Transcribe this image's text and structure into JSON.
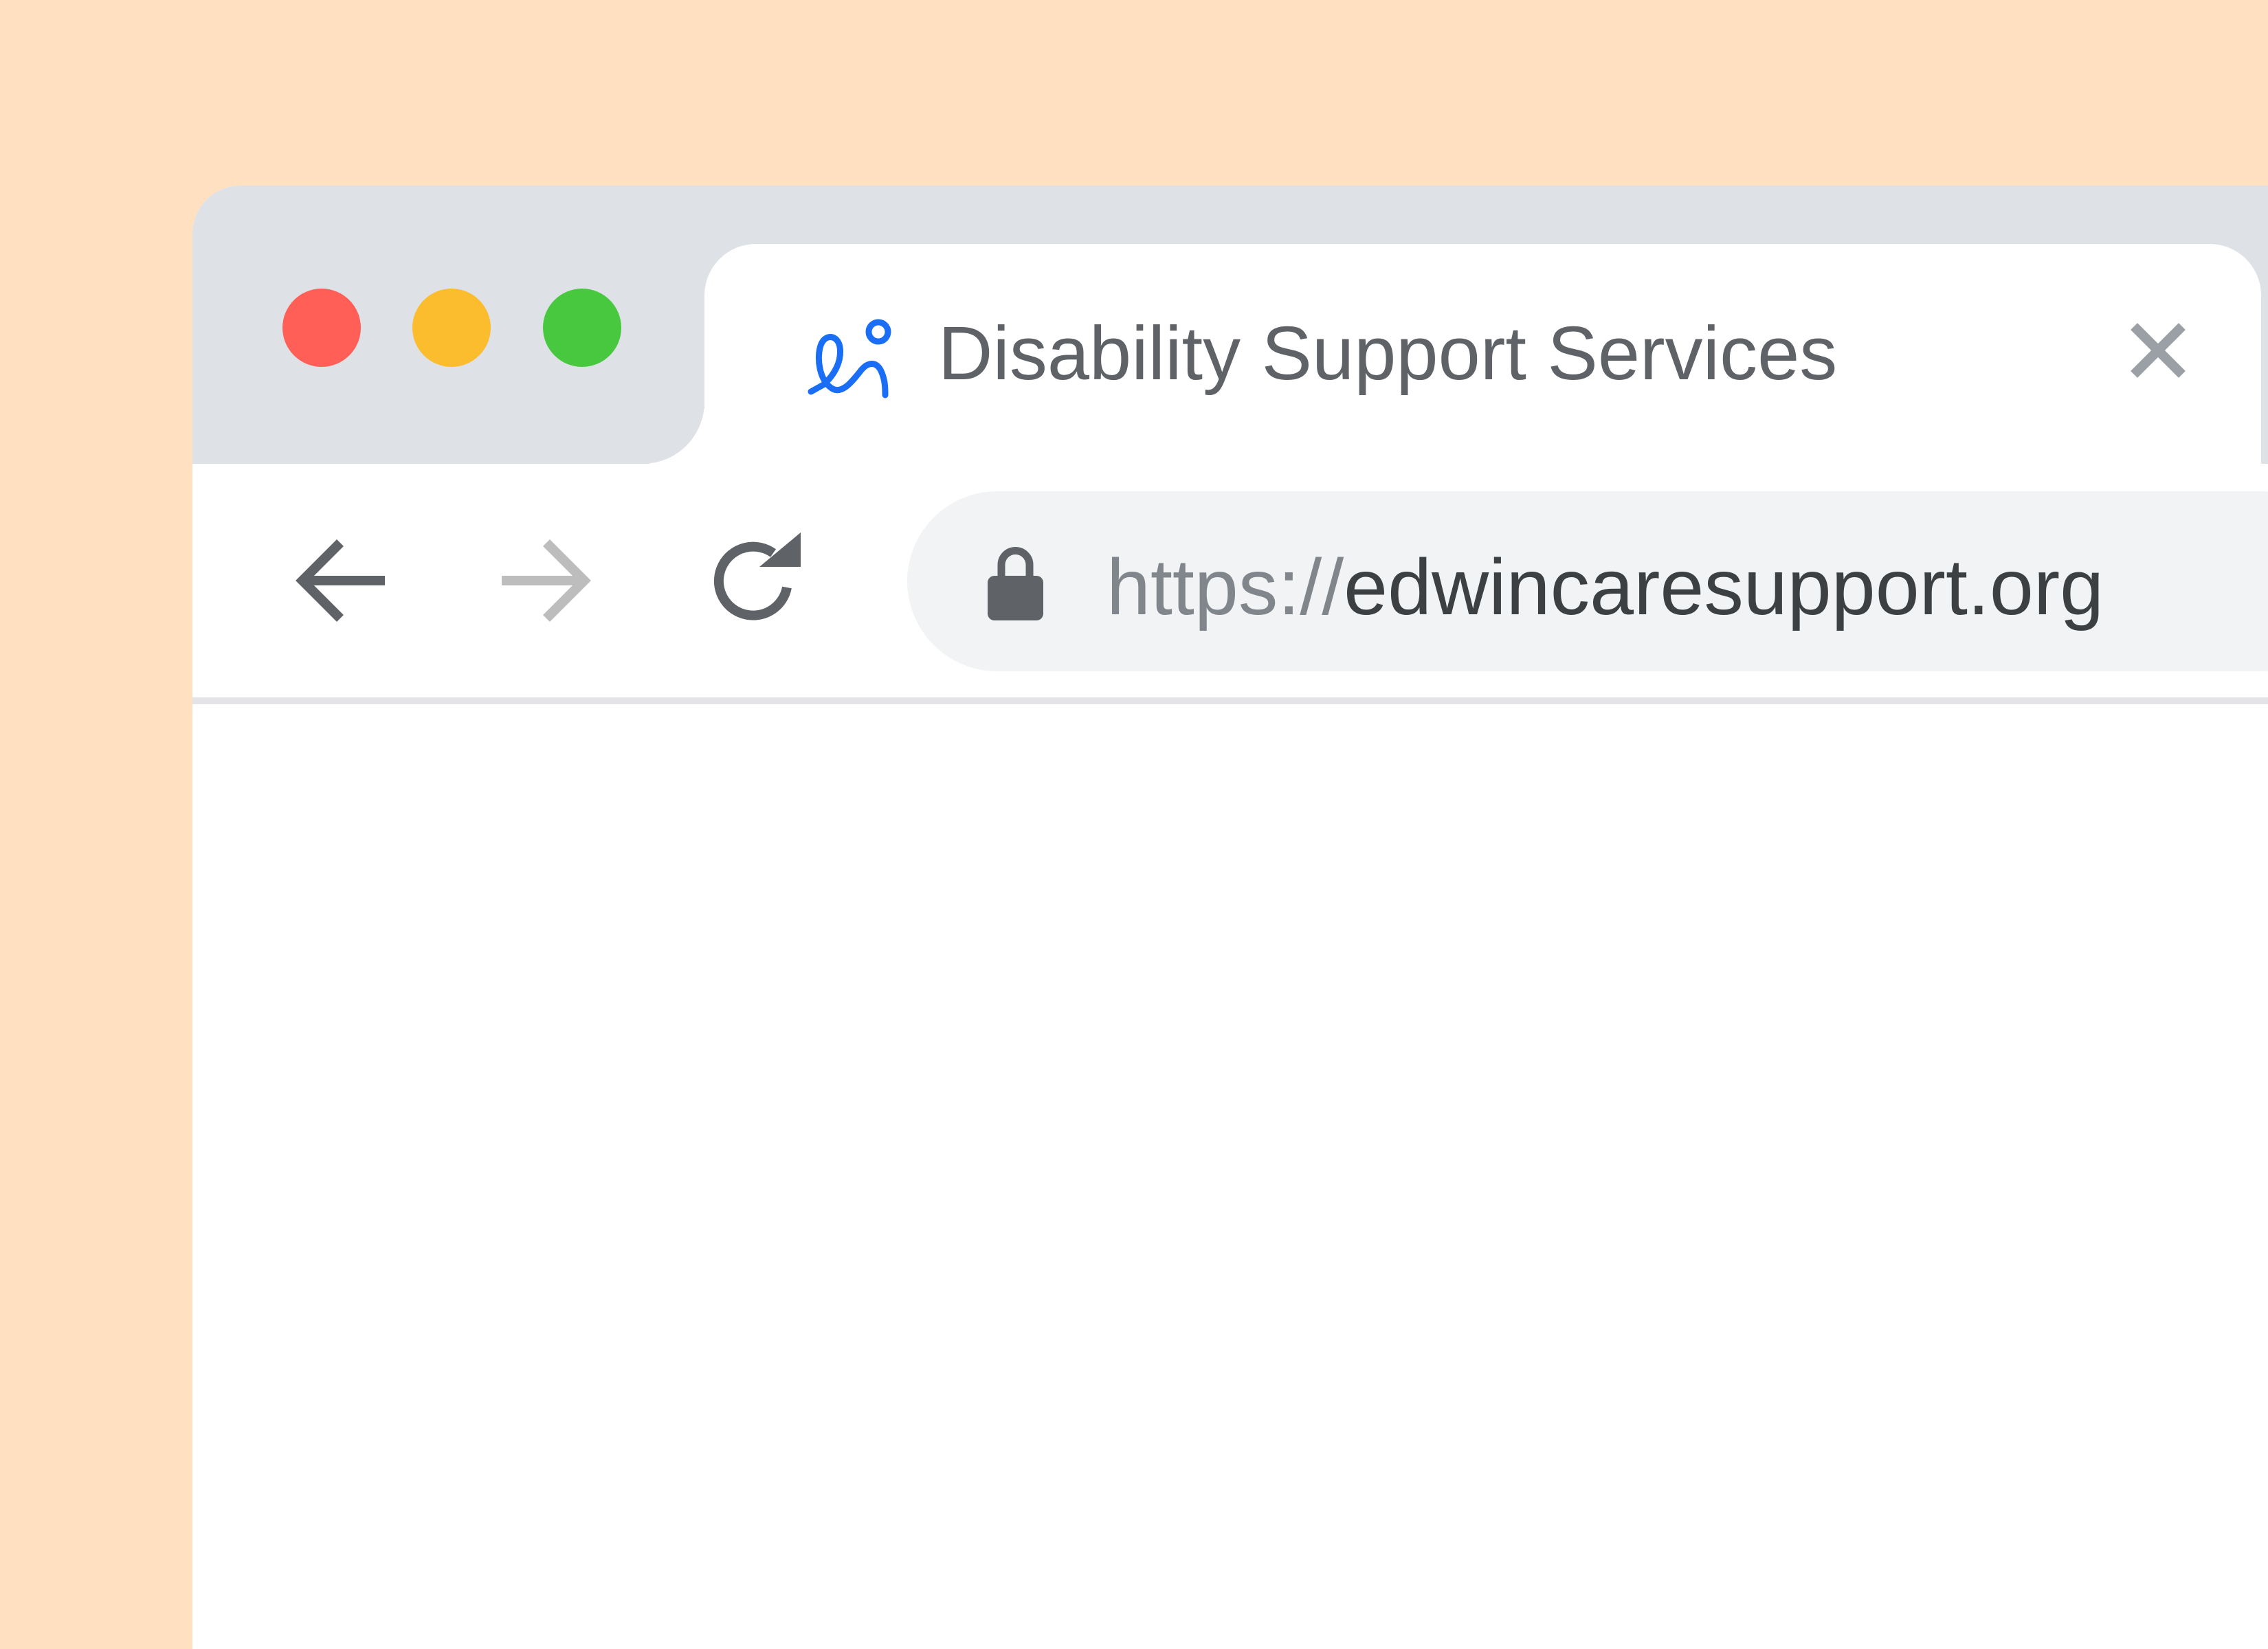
{
  "colors": {
    "background": "#FFE0C0",
    "tab_strip": "#DEE1E6",
    "tab": "#FFFFFF",
    "omnibox": "#F1F3F4",
    "divider": "#E3E3E8",
    "traffic_close": "#FF5F57",
    "traffic_minimize": "#FBBC2E",
    "traffic_zoom": "#48C83F",
    "accent_blue": "#1A6EF5",
    "icon_dark": "#5F6368",
    "icon_disabled": "#BDBDBD",
    "text_dark": "#3C4043",
    "text_muted": "#80868B",
    "close_icon": "#9AA0A6"
  },
  "window_controls": {
    "close": "close-button",
    "minimize": "minimize-button",
    "zoom": "zoom-button"
  },
  "tab": {
    "icon": "people-logo-icon",
    "title": "Disability Support Services",
    "close_icon": "close-icon"
  },
  "toolbar": {
    "back_icon": "arrow-left-icon",
    "forward_icon": "arrow-right-icon",
    "forward_enabled": false,
    "reload_icon": "reload-icon"
  },
  "address_bar": {
    "lock_icon": "lock-icon",
    "scheme": "https://",
    "host": "edwincaresupport.org"
  }
}
